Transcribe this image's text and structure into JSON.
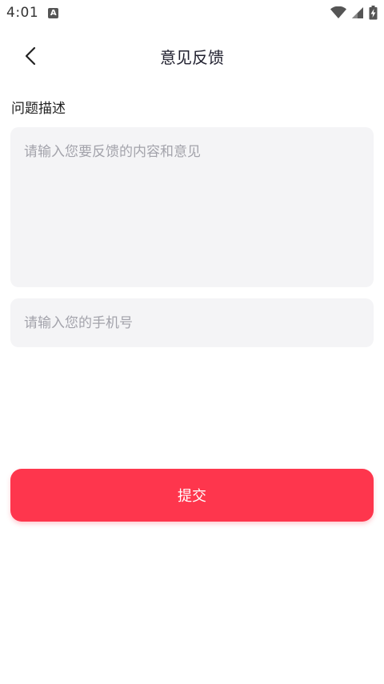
{
  "status_bar": {
    "time": "4:01",
    "notification_icon": "A"
  },
  "header": {
    "title": "意见反馈"
  },
  "form": {
    "description_label": "问题描述",
    "description_placeholder": "请输入您要反馈的内容和意见",
    "phone_placeholder": "请输入您的手机号",
    "submit_label": "提交"
  },
  "colors": {
    "accent": "#fe364d",
    "input_bg": "#f4f4f6",
    "placeholder": "#a3a3ab"
  }
}
